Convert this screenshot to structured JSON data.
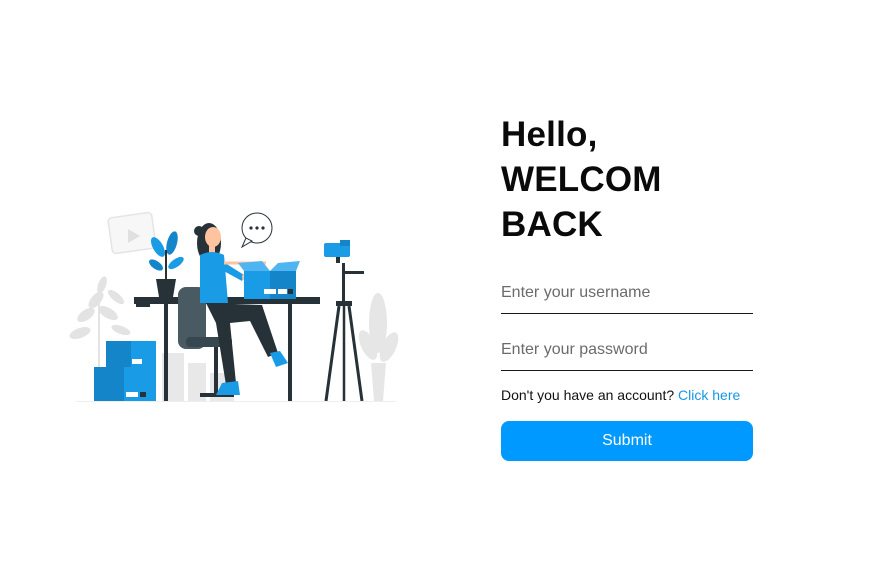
{
  "greeting": {
    "line1": "Hello,",
    "line2": "WELCOM BACK"
  },
  "form": {
    "username_placeholder": "Enter your username",
    "username_value": "",
    "password_placeholder": "Enter your password",
    "password_value": "",
    "signup_prompt": "Don't you have an account?",
    "signup_link": "Click here",
    "submit_label": "Submit"
  },
  "colors": {
    "accent": "#0099ff",
    "link": "#1597e5",
    "illustration_blue": "#1a9be6",
    "illustration_dark": "#263238",
    "illustration_gray": "#e6e6e6"
  },
  "illustration": {
    "icon": "woman-packing-boxes-illustration",
    "speech_bubble_text": "..."
  }
}
